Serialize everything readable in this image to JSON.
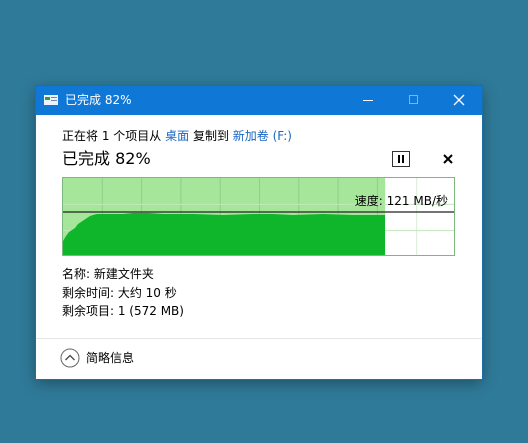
{
  "window": {
    "title": "已完成 82%",
    "accent_color": "#0f78d7"
  },
  "copy": {
    "prefix": "正在将 1 个项目从",
    "source": "桌面",
    "middle": "复制到",
    "destination": "新加卷 (F:)",
    "status_title": "已完成 82%",
    "progress_percent": 82,
    "speed_label": "速度: 121 MB/秒"
  },
  "details": {
    "name": "名称: 新建文件夹",
    "time_remaining": "剩余时间: 大约 10 秒",
    "items_remaining": "剩余项目: 1 (572 MB)"
  },
  "footer": {
    "toggle_label": "简略信息"
  },
  "icons": {
    "app": "file-copy-icon",
    "pause": "pause-icon",
    "cancel": "close-icon",
    "toggle": "chevron-up-icon"
  }
}
